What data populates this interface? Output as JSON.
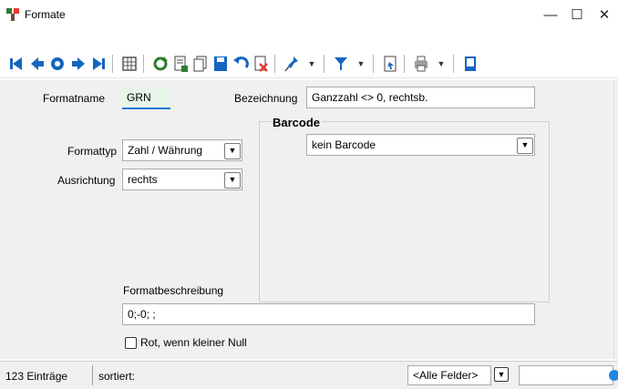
{
  "window": {
    "title": "Formate",
    "minimize": "—",
    "maximize": "☐",
    "close": "✕"
  },
  "toolbar": {
    "icons": [
      "first-record-icon",
      "previous-record-icon",
      "search-icon",
      "next-record-icon",
      "last-record-icon",
      "table-view-icon",
      "refresh-icon",
      "new-record-icon",
      "copy-record-icon",
      "save-icon",
      "undo-icon",
      "delete-icon",
      "pin-icon",
      "filter-icon",
      "document-icon",
      "print-icon",
      "close-window-icon"
    ]
  },
  "form": {
    "formatname_label": "Formatname",
    "formatname_value": "GRN",
    "bezeichnung_label": "Bezeichnung",
    "bezeichnung_value": "Ganzzahl <> 0, rechtsb.",
    "formattyp_label": "Formattyp",
    "formattyp_value": "Zahl / Währung",
    "ausrichtung_label": "Ausrichtung",
    "ausrichtung_value": "rechts",
    "barcode_group_label": "Barcode",
    "barcode_value": "kein Barcode",
    "formatbeschreibung_label": "Formatbeschreibung",
    "formatbeschreibung_value": "0;-0; ;",
    "rot_checkbox_label": "Rot, wenn kleiner Null",
    "rot_checked": false
  },
  "status": {
    "count": "123 Einträge",
    "sorted": "sortiert:",
    "field_filter": "<Alle Felder>",
    "search_value": ""
  },
  "colors": {
    "accent": "#1565c0",
    "input_focus_bg": "#e8f5e9",
    "content_bg": "#f0f0f0"
  }
}
